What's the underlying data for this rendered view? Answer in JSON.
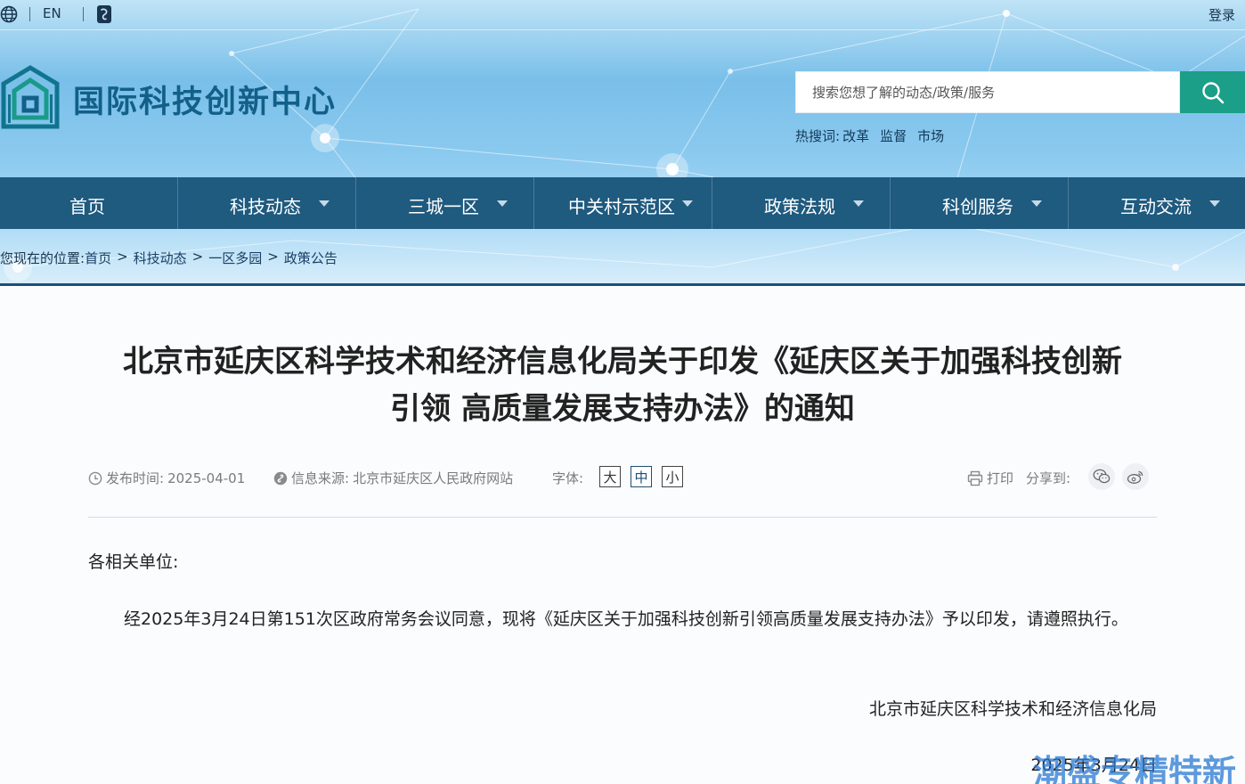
{
  "topbar": {
    "lang_label": "EN",
    "login_label": "登录",
    "globe_icon": "globe-icon",
    "mini_program_icon": "mini-program-icon"
  },
  "header": {
    "logo_text": "国际科技创新中心",
    "search": {
      "placeholder": "搜索您想了解的动态/政策/服务",
      "button_icon": "search-icon"
    },
    "hot_label": "热搜词:",
    "hot_words": [
      "改革",
      "监督",
      "市场"
    ]
  },
  "nav": {
    "items": [
      {
        "label": "首页",
        "has_caret": false
      },
      {
        "label": "科技动态",
        "has_caret": true
      },
      {
        "label": "三城一区",
        "has_caret": true
      },
      {
        "label": "中关村示范区",
        "has_caret": true
      },
      {
        "label": "政策法规",
        "has_caret": true
      },
      {
        "label": "科创服务",
        "has_caret": true
      },
      {
        "label": "互动交流",
        "has_caret": true
      }
    ]
  },
  "breadcrumb": {
    "prefix": "您现在的位置:",
    "items": [
      "首页",
      "科技动态",
      "一区多园",
      "政策公告"
    ],
    "separator": ">"
  },
  "article": {
    "title_line1": "北京市延庆区科学技术和经济信息化局关于印发《延庆区关于加强科技创新",
    "title_line2": "引领 高质量发展支持办法》的通知",
    "meta": {
      "date_label": "发布时间:",
      "date_value": "2025-04-01",
      "source_label": "信息来源:",
      "source_value": "北京市延庆区人民政府网站",
      "font_label": "字体:",
      "font_sizes": [
        "大",
        "中",
        "小"
      ],
      "active_font_size": "中",
      "print_label": "打印",
      "share_label": "分享到:"
    },
    "salutation": "各相关单位:",
    "body": "经2025年3月24日第151次区政府常务会议同意，现将《延庆区关于加强科技创新引领高质量发展支持办法》予以印发，请遵照执行。",
    "sign_org": "北京市延庆区科学技术和经济信息化局",
    "sign_date": "2025年3月24日"
  },
  "watermark": "潮盛专精特新",
  "colors": {
    "nav_bg": "#1f5a7f",
    "search_button": "#1b9f88",
    "logo_text": "#12608a",
    "header_rule": "#1d4f74"
  }
}
